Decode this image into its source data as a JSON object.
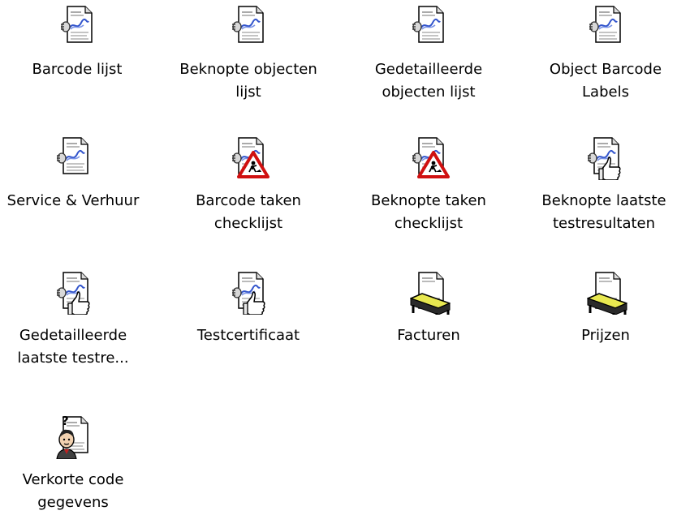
{
  "view": {
    "items": [
      {
        "label": "Barcode lijst",
        "icon": "report-barcode-icon"
      },
      {
        "label": "Beknopte objecten\nlijst",
        "icon": "report-barcode-icon"
      },
      {
        "label": "Gedetailleerde\nobjecten lijst",
        "icon": "report-barcode-icon"
      },
      {
        "label": "Object Barcode\nLabels",
        "icon": "report-barcode-icon"
      },
      {
        "label": "Service & Verhuur",
        "icon": "report-barcode-icon"
      },
      {
        "label": "Barcode taken\nchecklijst",
        "icon": "report-roadwork-warning-icon"
      },
      {
        "label": "Beknopte taken\nchecklijst",
        "icon": "report-roadwork-warning-icon"
      },
      {
        "label": "Beknopte laatste\ntestresultaten",
        "icon": "report-thumbs-up-icon"
      },
      {
        "label": "Gedetailleerde\nlaatste testre...",
        "icon": "report-thumbs-up-icon"
      },
      {
        "label": "Testcertificaat",
        "icon": "report-thumbs-up-icon"
      },
      {
        "label": "Facturen",
        "icon": "report-table-icon"
      },
      {
        "label": "Prijzen",
        "icon": "report-table-icon"
      },
      {
        "label": "Verkorte code\ngegevens",
        "icon": "report-person-question-icon"
      }
    ]
  }
}
